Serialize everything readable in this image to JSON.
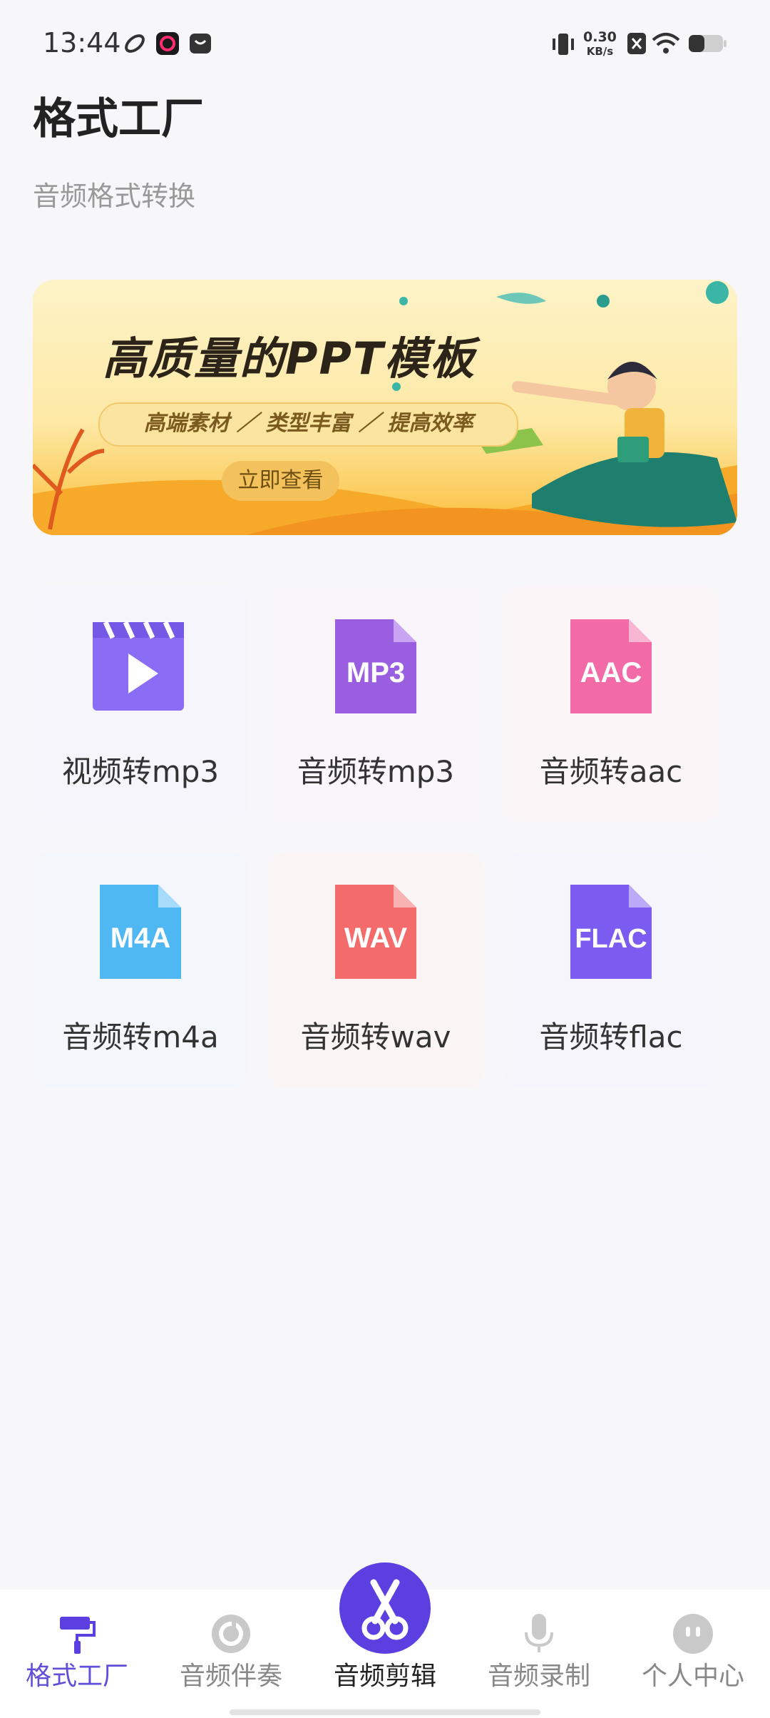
{
  "status_bar": {
    "time": "13:44",
    "speed_value": "0.30",
    "speed_unit": "KB/s"
  },
  "header": {
    "title": "格式工厂",
    "subtitle": "音频格式转换"
  },
  "banner": {
    "title": "高质量的PPT模板",
    "tagline": "高端素材 ／ 类型丰富 ／ 提高效率",
    "button_label": "立即查看"
  },
  "tools": [
    {
      "label": "视频转mp3",
      "icon": "video-clapper-icon",
      "badge": "",
      "color": "#8b6cf5"
    },
    {
      "label": "音频转mp3",
      "icon": "mp3-file-icon",
      "badge": "MP3",
      "color": "#9a5fe0"
    },
    {
      "label": "音频转aac",
      "icon": "aac-file-icon",
      "badge": "AAC",
      "color": "#f26aa6"
    },
    {
      "label": "音频转m4a",
      "icon": "m4a-file-icon",
      "badge": "M4A",
      "color": "#4fb7f2"
    },
    {
      "label": "音频转wav",
      "icon": "wav-file-icon",
      "badge": "WAV",
      "color": "#f46b6b"
    },
    {
      "label": "音频转flac",
      "icon": "flac-file-icon",
      "badge": "FLAC",
      "color": "#7c5cf0"
    }
  ],
  "nav": {
    "items": [
      {
        "label": "格式工厂",
        "icon": "paint-roller-icon",
        "active": true
      },
      {
        "label": "音频伴奏",
        "icon": "music-disc-icon"
      },
      {
        "label": "音频剪辑",
        "icon": "scissors-icon"
      },
      {
        "label": "音频录制",
        "icon": "microphone-icon"
      },
      {
        "label": "个人中心",
        "icon": "face-icon"
      }
    ]
  },
  "colors": {
    "accent": "#5b3fe0",
    "active_nav": "#5f4fd9"
  }
}
